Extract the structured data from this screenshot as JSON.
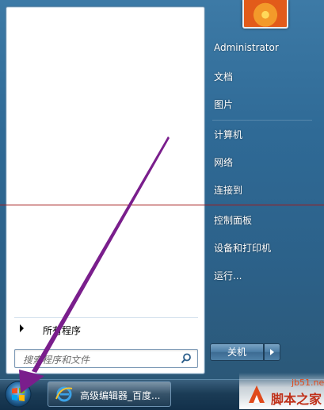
{
  "start_menu": {
    "left": {
      "all_programs_label": "所有程序",
      "search_placeholder": "搜索程序和文件"
    },
    "right": {
      "items": [
        {
          "label": "Administrator"
        },
        {
          "label": "文档"
        },
        {
          "label": "图片"
        },
        {
          "label": "计算机"
        },
        {
          "label": "网络"
        },
        {
          "label": "连接到"
        },
        {
          "label": "控制面板"
        },
        {
          "label": "设备和打印机"
        },
        {
          "label": "运行..."
        }
      ],
      "shutdown_label": "关机"
    }
  },
  "taskbar": {
    "window_button_label": "高级编辑器_百度..."
  },
  "watermark": {
    "site": "jb51.net",
    "brand": "脚本之家"
  },
  "icons": {
    "start": "windows-logo-icon",
    "browser": "internet-explorer-icon",
    "search": "magnifier-icon"
  },
  "colors": {
    "annotation_arrow": "#7a1e8c",
    "annotation_line": "#a31a1a"
  }
}
